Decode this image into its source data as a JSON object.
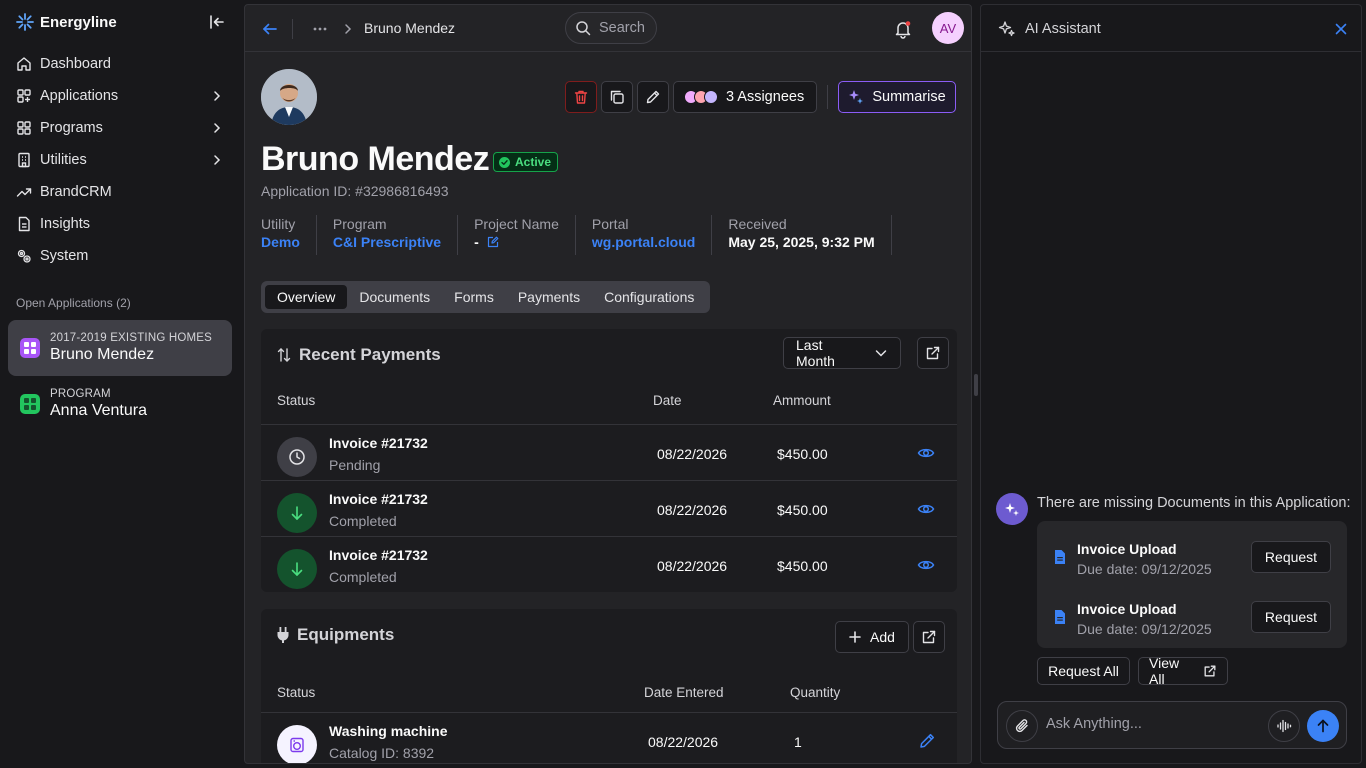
{
  "app": {
    "name": "Energyline"
  },
  "sidebar": {
    "items": [
      {
        "label": "Dashboard"
      },
      {
        "label": "Applications"
      },
      {
        "label": "Programs"
      },
      {
        "label": "Utilities"
      },
      {
        "label": "BrandCRM"
      },
      {
        "label": "Insights"
      },
      {
        "label": "System"
      }
    ],
    "open_section_label": "Open Applications (2)",
    "open_apps": [
      {
        "subtitle": "2017-2019 EXISTING HOMES",
        "name": "Bruno Mendez",
        "color": "#a855f7"
      },
      {
        "subtitle": "PROGRAM",
        "name": "Anna Ventura",
        "color": "#22c55e"
      }
    ]
  },
  "topbar": {
    "breadcrumb_current": "Bruno Mendez",
    "search_placeholder": "Search",
    "avatar_initials": "AV"
  },
  "profile": {
    "name": "Bruno Mendez",
    "status": "Active",
    "application_id": "Application ID: #32986816493",
    "assignees_label": "3 Assignees",
    "summarise_label": "Summarise",
    "meta": [
      {
        "label": "Utility",
        "value": "Demo"
      },
      {
        "label": "Program",
        "value": "C&I Prescriptive"
      },
      {
        "label": "Project Name",
        "value": "-"
      },
      {
        "label": "Portal",
        "value": "wg.portal.cloud"
      },
      {
        "label": "Received",
        "value": "May 25, 2025,  9:32 PM"
      }
    ]
  },
  "tabs": [
    {
      "label": "Overview"
    },
    {
      "label": "Documents"
    },
    {
      "label": "Forms"
    },
    {
      "label": "Payments"
    },
    {
      "label": "Configurations"
    }
  ],
  "payments": {
    "title": "Recent Payments",
    "filter": "Last Month",
    "columns": {
      "status": "Status",
      "date": "Date",
      "amount": "Ammount"
    },
    "rows": [
      {
        "title": "Invoice #21732",
        "status": "Pending",
        "date": "08/22/2026",
        "amount": "$450.00"
      },
      {
        "title": "Invoice #21732",
        "status": "Completed",
        "date": "08/22/2026",
        "amount": "$450.00"
      },
      {
        "title": "Invoice #21732",
        "status": "Completed",
        "date": "08/22/2026",
        "amount": "$450.00"
      }
    ]
  },
  "equipments": {
    "title": "Equipments",
    "add_label": "Add",
    "columns": {
      "status": "Status",
      "date": "Date Entered",
      "quantity": "Quantity"
    },
    "rows": [
      {
        "title": "Washing machine",
        "sub": "Catalog ID: 8392",
        "date": "08/22/2026",
        "quantity": "1"
      }
    ]
  },
  "ai": {
    "title": "AI Assistant",
    "message": "There are missing Documents in this Application:",
    "documents": [
      {
        "title": "Invoice Upload",
        "due": "Due date: 09/12/2025",
        "action": "Request"
      },
      {
        "title": "Invoice Upload",
        "due": "Due date: 09/12/2025",
        "action": "Request"
      }
    ],
    "request_all_label": "Request All",
    "view_all_label": "View All",
    "input_placeholder": "Ask Anything..."
  },
  "colors": {
    "accent": "#3b82f6",
    "active_green": "#4ade80",
    "summarise_border": "#8b5cf6",
    "delete_red": "#ef4444"
  }
}
